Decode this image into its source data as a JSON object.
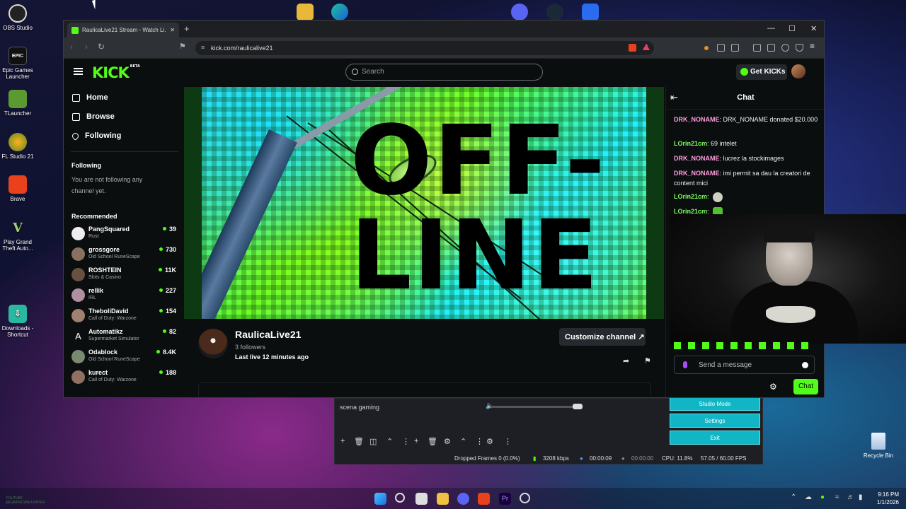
{
  "desktop": {
    "icons": [
      "OBS Studio",
      "Epic Games Launcher",
      "TLauncher",
      "FL Studio 21",
      "Brave",
      "Play Grand Theft Auto...",
      "Downloads - Shortcut"
    ],
    "recycle_bin": "Recycle Bin",
    "watermark": "YOUTUBE\n@GAMINGWALLPAPER"
  },
  "browser": {
    "tab_title": "RaulicaLive21 Stream - Watch Li...",
    "url": "kick.com/raulicalive21"
  },
  "kick": {
    "search_placeholder": "Search",
    "get_kicks": "Get KICKs",
    "nav": [
      "Home",
      "Browse",
      "Following"
    ],
    "following_header": "Following",
    "following_empty": "You are not following any channel yet.",
    "recommended_header": "Recommended",
    "recommended": [
      {
        "name": "PangSquared",
        "game": "Rust",
        "viewers": "39"
      },
      {
        "name": "grossgore",
        "game": "Old School RuneScape",
        "viewers": "730"
      },
      {
        "name": "ROSHTEIN",
        "game": "Slots & Casino",
        "viewers": "11K"
      },
      {
        "name": "rellik",
        "game": "IRL",
        "viewers": "227"
      },
      {
        "name": "TheboliDavid",
        "game": "Call of Duty: Warzone",
        "viewers": "154"
      },
      {
        "name": "Automatikz",
        "game": "Supermarket Simulator",
        "viewers": "82"
      },
      {
        "name": "Odablock",
        "game": "Old School RuneScape",
        "viewers": "8.4K"
      },
      {
        "name": "kurect",
        "game": "Call of Duty: Warzone",
        "viewers": "188"
      }
    ],
    "offline_text": "OFF-LINE",
    "channel": {
      "name": "RaulicaLive21",
      "followers": "3 followers",
      "last_live": "Last live 12 minutes ago",
      "customize": "Customize channel"
    },
    "chat": {
      "title": "Chat",
      "messages": [
        {
          "user": "DRK_NONAME",
          "text": "DRK_NONAME donated $20.000",
          "color": "#ff9de0"
        },
        {
          "user": "LOrin21cm",
          "text": "69 intelet",
          "color": "#7dff5a"
        },
        {
          "user": "DRK_NONAME",
          "text": "lucrez la stockimages",
          "color": "#ff9de0"
        },
        {
          "user": "DRK_NONAME",
          "text": "imi permit sa dau la creatori de content mici",
          "color": "#ff9de0"
        },
        {
          "user": "LOrin21cm",
          "text": "",
          "color": "#7dff5a"
        },
        {
          "user": "LOrin21cm",
          "text": "",
          "color": "#7dff5a"
        }
      ],
      "input_placeholder": "Send a message",
      "send": "Chat"
    }
  },
  "obs": {
    "scene": "scena gaming",
    "controls": [
      "Studio Mode",
      "Settings",
      "Exit"
    ],
    "status": {
      "dropped": "Dropped Frames 0 (0.0%)",
      "bitrate": "3208 kbps",
      "rec_time": "00:00:09",
      "stream_time": "00:00:00",
      "cpu": "CPU: 11.8%",
      "fps": "57.05 / 60.00 FPS"
    }
  },
  "taskbar": {
    "time": "9:16 PM",
    "date": "1/1/2026"
  }
}
